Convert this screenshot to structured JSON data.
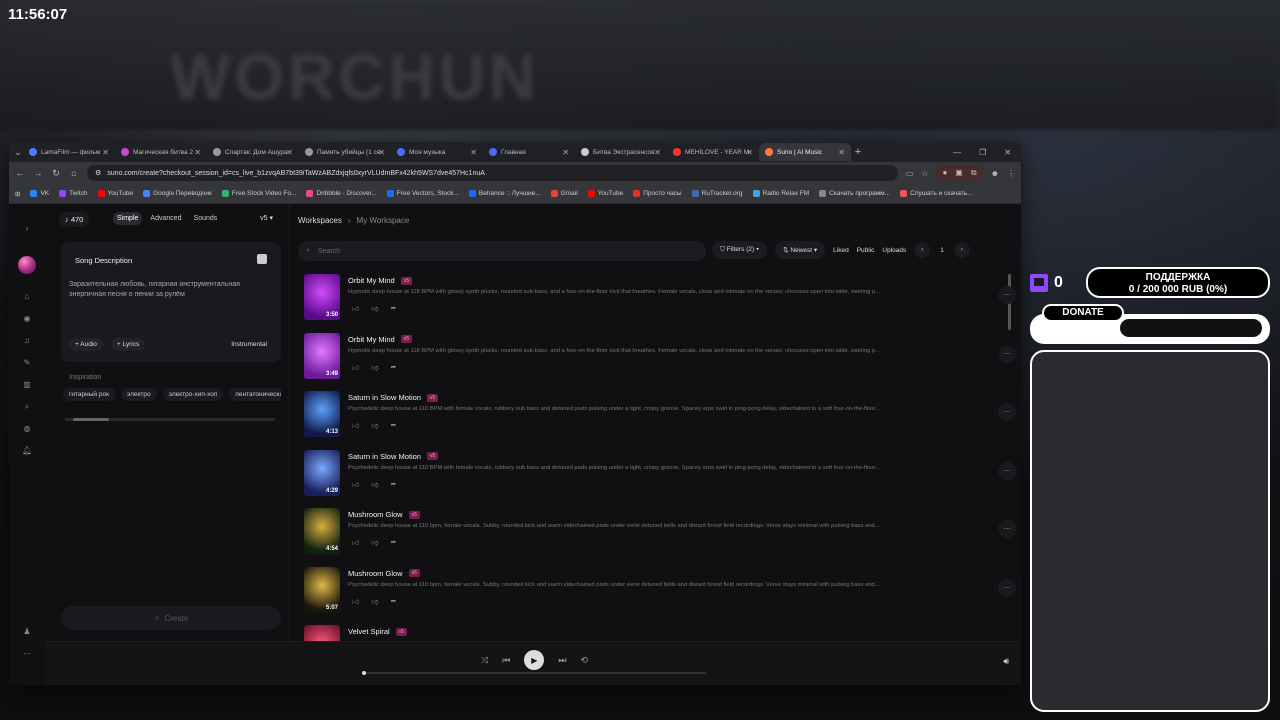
{
  "stream": {
    "clock": "11:56:07",
    "bg_text": "WORCHUN"
  },
  "browser": {
    "tabs": [
      {
        "label": "LamaFilm — фильм",
        "color": "#4a7dff"
      },
      {
        "label": "Магическая битва 2",
        "color": "#c94ad8"
      },
      {
        "label": "Спартак: Дом Ашура",
        "color": "#999999"
      },
      {
        "label": "Память убийцы (1 се",
        "color": "#999999"
      },
      {
        "label": "Моя музыка",
        "color": "#4a6dff"
      },
      {
        "label": "Главная",
        "color": "#4a6dff"
      },
      {
        "label": "Битва Экстрасенсов",
        "color": "#cccccc"
      },
      {
        "label": "MEHİLOVE - YEAR M",
        "color": "#ff3030"
      },
      {
        "label": "Suno | AI Music",
        "color": "#ff7a3a"
      }
    ],
    "url": "suno.com/create?checkout_session_id=cs_live_b1zvqAB7bt39iTaWzABZdxjqfs0xyrVLUdmBFx42kh5WS7dve457Hc1nuA",
    "bookmarks": [
      {
        "label": "VK",
        "color": "#2d7fff"
      },
      {
        "label": "Twitch",
        "color": "#9146ff"
      },
      {
        "label": "YouTube",
        "color": "#ff0000"
      },
      {
        "label": "Google Переводчик",
        "color": "#4285f4"
      },
      {
        "label": "Free Stock Video Fo...",
        "color": "#2bb673"
      },
      {
        "label": "Dribbble - Discover...",
        "color": "#ea4c89"
      },
      {
        "label": "Free Vectors, Stock...",
        "color": "#1273eb"
      },
      {
        "label": "Behance :: Лучшие...",
        "color": "#1769ff"
      },
      {
        "label": "Gmail",
        "color": "#ea4335"
      },
      {
        "label": "YouTube",
        "color": "#ff0000"
      },
      {
        "label": "Просто часы",
        "color": "#d33"
      },
      {
        "label": "RuTracker.org",
        "color": "#3d6aa8"
      },
      {
        "label": "Radio Relax FM",
        "color": "#4aa0d8"
      },
      {
        "label": "Скачать программ...",
        "color": "#888888"
      },
      {
        "label": "Слушать и скачать...",
        "color": "#e55"
      }
    ]
  },
  "suno": {
    "credits": "470",
    "modes": [
      "Simple",
      "Advanced",
      "Sounds"
    ],
    "version": "v5",
    "desc_title": "Song Description",
    "desc_text": "Заразительная любовь, гитарная инструментальная энергичная песня о пении за рулём",
    "audio_btn": "Audio",
    "lyrics_btn": "Lyrics",
    "instrumental": "Instrumental",
    "inspiration_label": "Inspiration",
    "chips": [
      "гитарный рок",
      "электро",
      "электро-хип-хоп",
      "пентатоническая"
    ],
    "create_label": "Create",
    "crumb_root": "Workspaces",
    "crumb_current": "My Workspace",
    "search_placeholder": "Search",
    "filters_label": "Filters (2)",
    "sort_label": "Newest",
    "liked": "Liked",
    "public": "Public",
    "uploads": "Uploads",
    "page": "1",
    "songs": [
      {
        "title": "Orbit My Mind",
        "badge": "v5",
        "duration": "3:50",
        "desc": "Hypnotic deep house at 118 BPM with glossy synth plucks, rounded sub-bass, and a four-on-the-floor kick that breathes. Female vocals, close and intimate on the verses; choruses open into wide, swirling p...",
        "c1": "#d24bff",
        "c2": "#5a0a8a"
      },
      {
        "title": "Orbit My Mind",
        "badge": "v5",
        "duration": "3:49",
        "desc": "Hypnotic deep house at 118 BPM with glossy synth plucks, rounded sub-bass, and a four-on-the-floor kick that breathes. Female vocals, close and intimate on the verses; choruses open into wide, swirling p...",
        "c1": "#e07aff",
        "c2": "#6a1a9a"
      },
      {
        "title": "Saturn in Slow Motion",
        "badge": "v5",
        "duration": "4:13",
        "desc": "Psychedelic deep house at 110 BPM with female vocals, rubbery sub bass and detuned pads pulsing under a tight, crispy groove. Spacey arps swirl in ping-pong delay, sidechained to a soft four-on-the-floor...",
        "c1": "#5fa0ff",
        "c2": "#0f1a4a"
      },
      {
        "title": "Saturn in Slow Motion",
        "badge": "v5",
        "duration": "4:29",
        "desc": "Psychedelic deep house at 110 BPM with female vocals, rubbery sub bass and detuned pads pulsing under a tight, crispy groove. Spacey arps swirl in ping-pong delay, sidechained to a soft four-on-the-floor...",
        "c1": "#7aa8ff",
        "c2": "#1a1f5a"
      },
      {
        "title": "Mushroom Glow",
        "badge": "v5",
        "duration": "4:54",
        "desc": "Psychedelic deep house at 110 bpm, female vocals. Subby, rounded kick and warm sidechained pads under eerie detuned bells and distant forest field recordings. Verse stays minimal with pulsing bass and...",
        "c1": "#d8b040",
        "c2": "#10200f"
      },
      {
        "title": "Mushroom Glow",
        "badge": "v5",
        "duration": "5:07",
        "desc": "Psychedelic deep house at 110 bpm, female vocals. Subby, rounded kick and warm sidechained pads under eerie detuned bells and distant forest field recordings. Verse stays minimal with pulsing bass and...",
        "c1": "#e0b84a",
        "c2": "#1a1608"
      },
      {
        "title": "Velvet Spiral",
        "badge": "v5",
        "duration": "",
        "desc": "",
        "c1": "#ff5a7a",
        "c2": "#6a0f2a"
      }
    ]
  },
  "overlay": {
    "twitch_count": "0",
    "support_title": "ПОДДЕРЖКА",
    "support_amount": "0 / 200 000 RUB (0%)",
    "donate": "DONATE"
  }
}
